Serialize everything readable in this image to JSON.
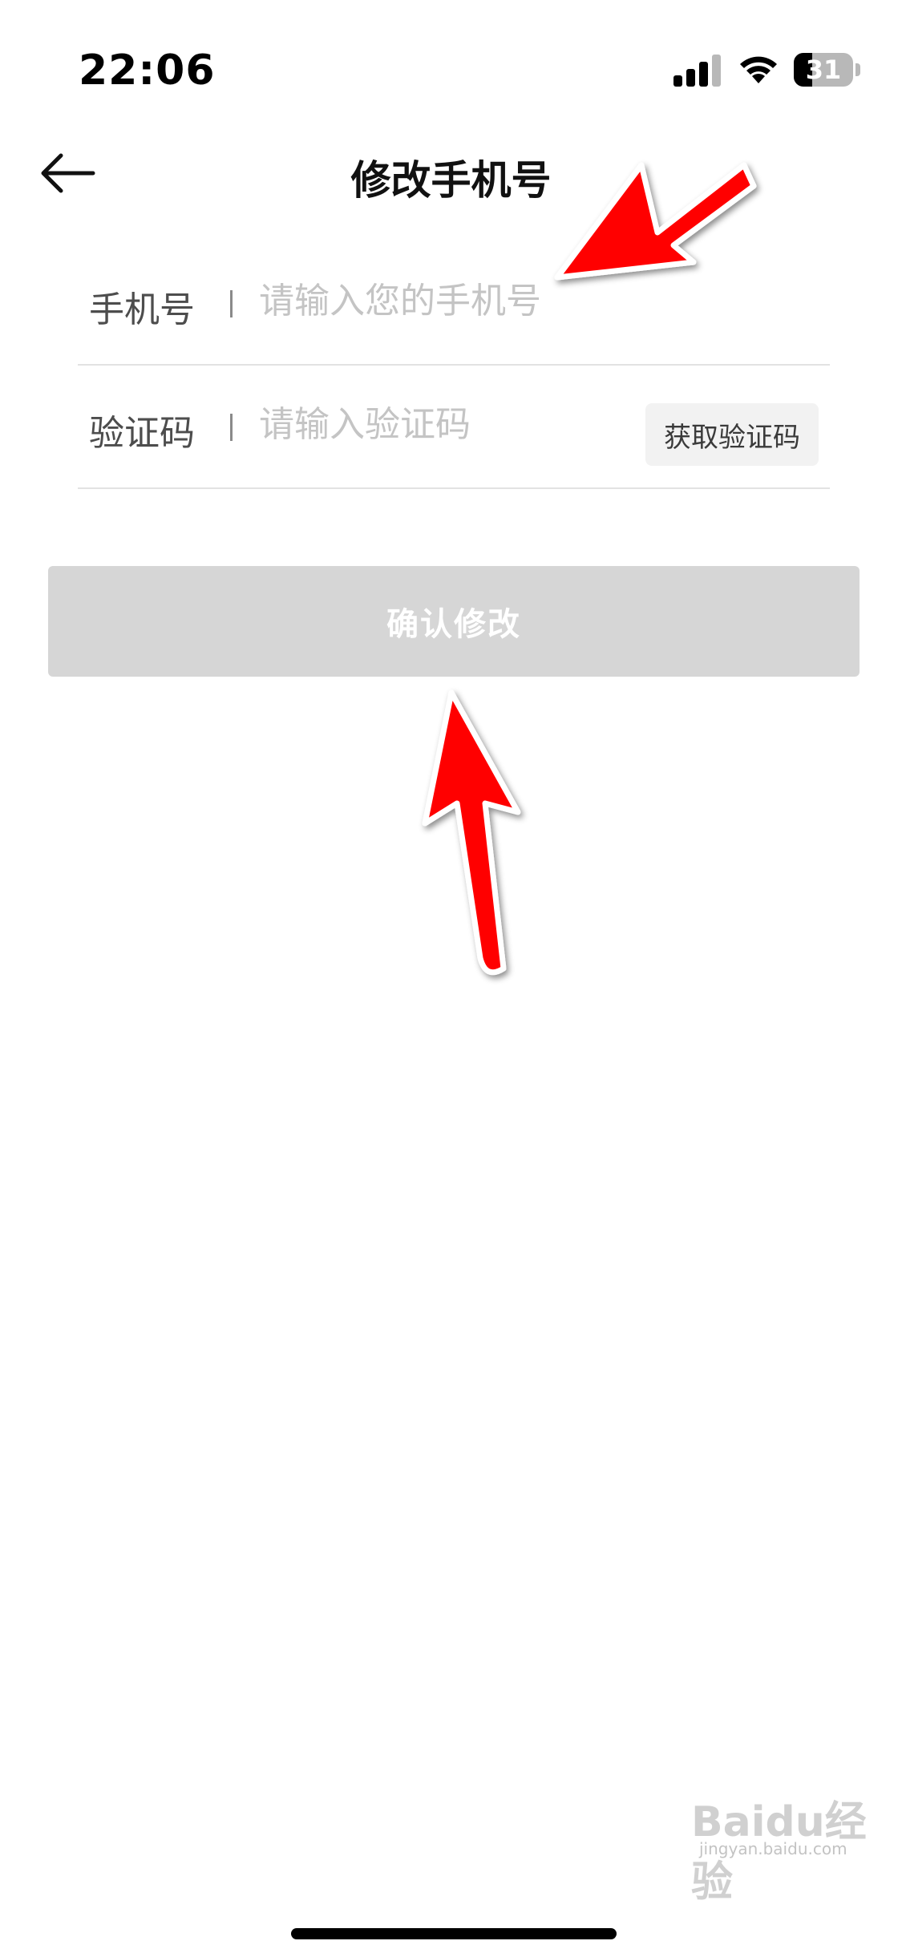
{
  "status_bar": {
    "time": "22:06",
    "battery_level": "31",
    "battery_fraction": 0.31,
    "signal_icon": "cellular-signal-icon",
    "wifi_icon": "wifi-icon",
    "battery_icon": "battery-icon"
  },
  "nav": {
    "back_icon": "arrow-left-icon",
    "title": "修改手机号"
  },
  "form": {
    "phone": {
      "label": "手机号",
      "placeholder": "请输入您的手机号",
      "value": ""
    },
    "code": {
      "label": "验证码",
      "placeholder": "请输入验证码",
      "value": "",
      "get_code_label": "获取验证码"
    },
    "confirm_label": "确认修改"
  },
  "watermark": {
    "text": "Baidu经验",
    "sub": "jingyan.baidu.com"
  },
  "colors": {
    "annotation_arrow": "#ff0000",
    "confirm_disabled_bg": "#d6d6d6",
    "placeholder": "#c4c4c4"
  }
}
